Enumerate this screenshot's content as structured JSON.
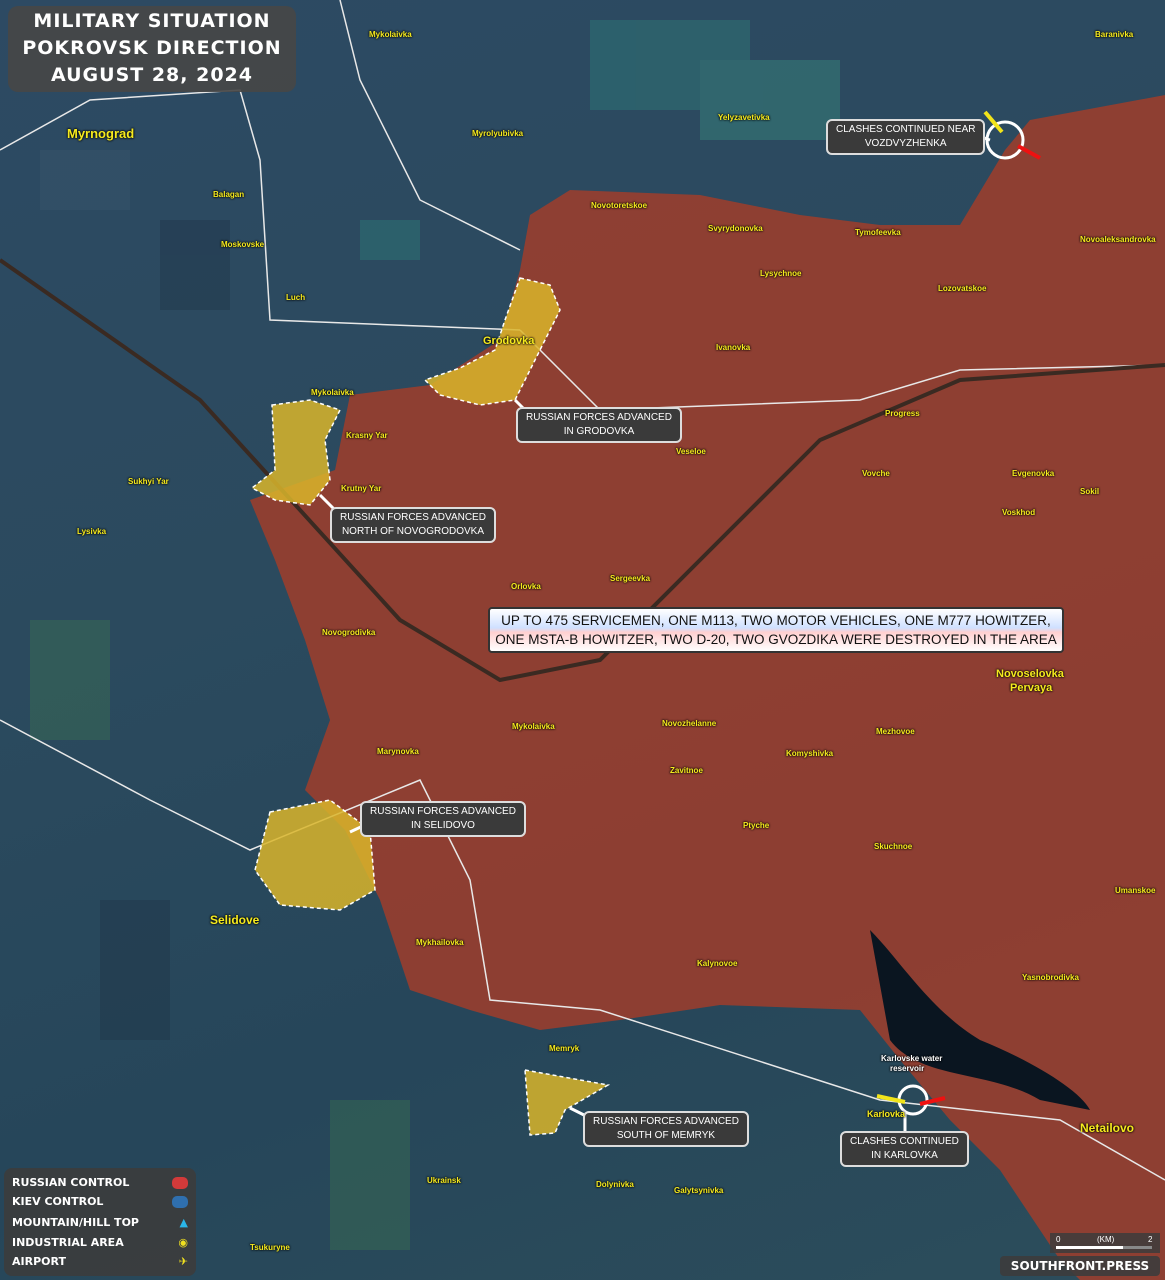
{
  "title": {
    "line1": "MILITARY SITUATION",
    "line2": "POKROVSK DIRECTION",
    "line3": "AUGUST 28, 2024"
  },
  "headline": {
    "line1": "UP TO 475 SERVICEMEN, ONE M113, TWO MOTOR VEHICLES, ONE M777 HOWITZER,",
    "line2": "ONE MSTA-B HOWITZER, TWO D-20, TWO GVOZDIKA WERE DESTROYED IN THE AREA"
  },
  "callouts": {
    "vozdvyzhenka": {
      "l1": "CLASHES CONTINUED NEAR",
      "l2": "VOZDVYZHENKA"
    },
    "grodovka": {
      "l1": "RUSSIAN FORCES ADVANCED",
      "l2": "IN GRODOVKA"
    },
    "novogrodovka": {
      "l1": "RUSSIAN FORCES ADVANCED",
      "l2": "NORTH OF NOVOGRODOVKA"
    },
    "selidovo": {
      "l1": "RUSSIAN FORCES ADVANCED",
      "l2": "IN SELIDOVO"
    },
    "memryk": {
      "l1": "RUSSIAN FORCES ADVANCED",
      "l2": "SOUTH OF MEMRYK"
    },
    "karlovka": {
      "l1": "CLASHES CONTINUED",
      "l2": "IN KARLOVKA"
    }
  },
  "towns": {
    "myrnograd": "Myrnograd",
    "mykolaivka_n": "Mykolaivka",
    "myrolyubivka": "Myrolyubivka",
    "yelyzavetivka": "Yelyzavetivka",
    "baranivka": "Baranivka",
    "balagan": "Balagan",
    "moskovske": "Moskovske",
    "luch": "Luch",
    "novotoretskoe": "Novotoretskoe",
    "svyrydonovka": "Svyrydonovka",
    "tymofeevka": "Tymofeevka",
    "novoaleksandrovka": "Novoaleksandrovka",
    "lysychnoe": "Lysychnoe",
    "lozovatskoe": "Lozovatskoe",
    "grodovka": "Grodovka",
    "ivanovka": "Ivanovka",
    "mykolaivka_w": "Mykolaivka",
    "krasny_yar": "Krasny Yar",
    "krutny_yar": "Krutny Yar",
    "sukhyi_yar": "Sukhyi Yar",
    "lysivka": "Lysivka",
    "progress": "Progress",
    "veseloe": "Veseloe",
    "vovche": "Vovche",
    "evgenovka": "Evgenovka",
    "sokil": "Sokil",
    "voskhod": "Voskhod",
    "orlovka": "Orlovka",
    "sergeevka": "Sergeevka",
    "novogrodivka": "Novogrodivka",
    "novoselovka": "Novoselovka",
    "pervaya": "Pervaya",
    "mykolaivka_s": "Mykolaivka",
    "novozhelanne": "Novozhelanne",
    "marynovka": "Marynovka",
    "komyshivka": "Komyshivka",
    "mezhovoe": "Mezhovoe",
    "zavitnoe": "Zavitnoe",
    "ptyche": "Ptyche",
    "skuchnoe": "Skuchnoe",
    "umanskoe": "Umanskoe",
    "selidove": "Selidove",
    "mykhailovka": "Mykhailovka",
    "kalynovoe": "Kalynovoe",
    "yasnobrodivka": "Yasnobrodivka",
    "memryk": "Memryk",
    "reservoir1": "Karlovske water",
    "reservoir2": "reservoir",
    "karlovka": "Karlovka",
    "netailovo": "Netailovo",
    "ukrainsk": "Ukrainsk",
    "dolynivka": "Dolynivka",
    "galytsynivka": "Galytsynivka",
    "tsukuryne": "Tsukuryne"
  },
  "legend": [
    {
      "label": "RUSSIAN CONTROL",
      "icon": "red-swatch",
      "color": "#d23a3a"
    },
    {
      "label": "KIEV CONTROL",
      "icon": "blue-swatch",
      "color": "#2f6fae"
    },
    {
      "label": "MOUNTAIN/HILL TOP",
      "icon": "triangle-icon",
      "color": "#2ab6e8"
    },
    {
      "label": "INDUSTRIAL AREA",
      "icon": "industrial-icon",
      "color": "#f0e020"
    },
    {
      "label": "AIRPORT",
      "icon": "airport-icon",
      "color": "#f0e020"
    }
  ],
  "scale": {
    "min": "0",
    "unit": "(KM)",
    "max": "2"
  },
  "brand": "SOUTHFRONT.PRESS",
  "colors": {
    "russian": "#a0412f",
    "advance": "#d9b52a",
    "kiev": "#2b4a5e"
  }
}
